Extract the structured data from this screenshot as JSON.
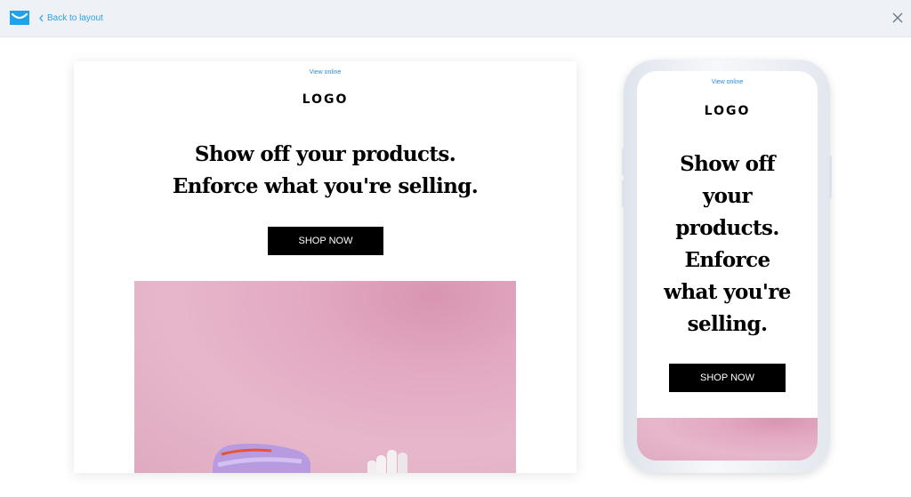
{
  "topbar": {
    "back_label": "Back to layout",
    "brand_color": "#29a3e6",
    "icons": [
      "brand-envelope-icon",
      "chevron-left-icon",
      "close-icon"
    ]
  },
  "email": {
    "view_online": "View online",
    "logo": "LOGO",
    "headline_line1": "Show off your products.",
    "headline_line2": "Enforce what you're selling.",
    "cta": "SHOP NOW",
    "image_background": "#e3a9c3"
  },
  "mobile_preview": {
    "view_online": "View online",
    "logo": "LOGO",
    "headline_line1": "Show off",
    "headline_line2": "your",
    "headline_line3": "products.",
    "headline_line4": "Enforce",
    "headline_line5": "what you're",
    "headline_line6": "selling.",
    "cta": "SHOP NOW"
  }
}
